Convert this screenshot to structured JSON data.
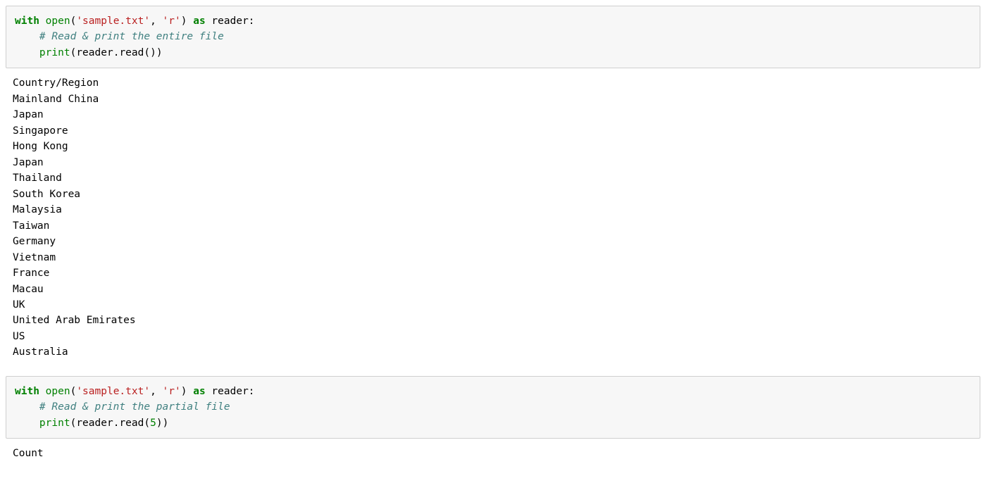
{
  "cell1": {
    "kw_with": "with",
    "fn_open": "open",
    "paren_open": "(",
    "str_file": "'sample.txt'",
    "comma": ", ",
    "str_mode": "'r'",
    "paren_close": ")",
    "kw_as": "as",
    "var_reader": " reader:",
    "indent": "    ",
    "comment": "# Read & print the entire file",
    "fn_print": "print",
    "paren_open2": "(",
    "expr_reader": "reader",
    "dot": ".",
    "fn_read": "read",
    "call_empty_open": "(",
    "call_empty_close": ")",
    "paren_close2": ")"
  },
  "output1": "Country/Region\nMainland China\nJapan\nSingapore\nHong Kong\nJapan\nThailand\nSouth Korea\nMalaysia\nTaiwan\nGermany\nVietnam\nFrance\nMacau\nUK\nUnited Arab Emirates\nUS\nAustralia\n",
  "cell2": {
    "kw_with": "with",
    "fn_open": "open",
    "paren_open": "(",
    "str_file": "'sample.txt'",
    "comma": ", ",
    "str_mode": "'r'",
    "paren_close": ")",
    "kw_as": "as",
    "var_reader": " reader:",
    "indent": "    ",
    "comment": "# Read & print the partial file",
    "fn_print": "print",
    "paren_open2": "(",
    "expr_reader": "reader",
    "dot": ".",
    "fn_read": "read",
    "call_arg_open": "(",
    "num_arg": "5",
    "call_arg_close": ")",
    "paren_close2": ")"
  },
  "output2": "Count"
}
